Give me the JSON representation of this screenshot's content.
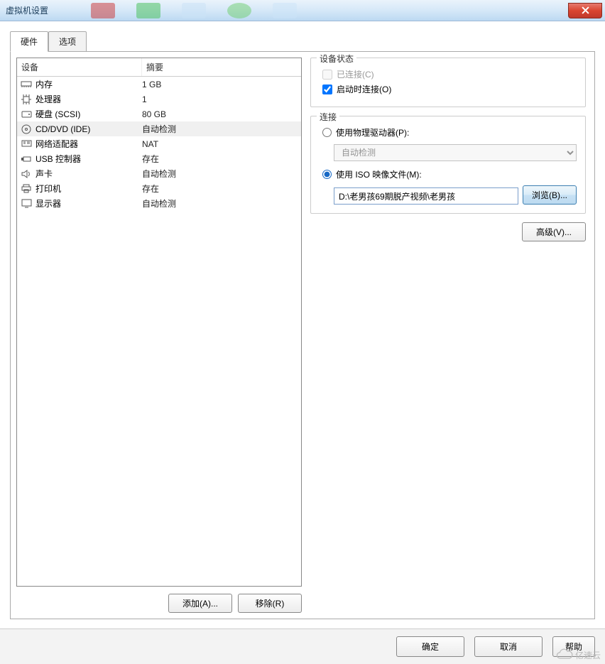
{
  "window": {
    "title": "虚拟机设置"
  },
  "tabs": {
    "hardware": "硬件",
    "options": "选项"
  },
  "device_header": {
    "device": "设备",
    "summary": "摘要"
  },
  "devices": [
    {
      "icon": "memory",
      "name": "内存",
      "summary": "1 GB",
      "selected": false
    },
    {
      "icon": "cpu",
      "name": "处理器",
      "summary": "1",
      "selected": false
    },
    {
      "icon": "disk",
      "name": "硬盘 (SCSI)",
      "summary": "80 GB",
      "selected": false
    },
    {
      "icon": "cd",
      "name": "CD/DVD (IDE)",
      "summary": "自动检测",
      "selected": true
    },
    {
      "icon": "net",
      "name": "网络适配器",
      "summary": "NAT",
      "selected": false
    },
    {
      "icon": "usb",
      "name": "USB 控制器",
      "summary": "存在",
      "selected": false
    },
    {
      "icon": "sound",
      "name": "声卡",
      "summary": "自动检测",
      "selected": false
    },
    {
      "icon": "printer",
      "name": "打印机",
      "summary": "存在",
      "selected": false
    },
    {
      "icon": "display",
      "name": "显示器",
      "summary": "自动检测",
      "selected": false
    }
  ],
  "buttons": {
    "add": "添加(A)...",
    "remove": "移除(R)",
    "browse": "浏览(B)...",
    "advanced": "高级(V)...",
    "ok": "确定",
    "cancel": "取消",
    "help": "帮助"
  },
  "device_status": {
    "title": "设备状态",
    "connected": "已连接(C)",
    "connected_checked": false,
    "connected_enabled": false,
    "on_power": "启动时连接(O)",
    "on_power_checked": true
  },
  "connection": {
    "title": "连接",
    "use_physical": "使用物理驱动器(P):",
    "physical_value": "自动检测",
    "use_iso": "使用 ISO 映像文件(M):",
    "iso_value": "D:\\老男孩69期脱产视频\\老男孩",
    "selected": "iso"
  },
  "watermark": "亿速云"
}
